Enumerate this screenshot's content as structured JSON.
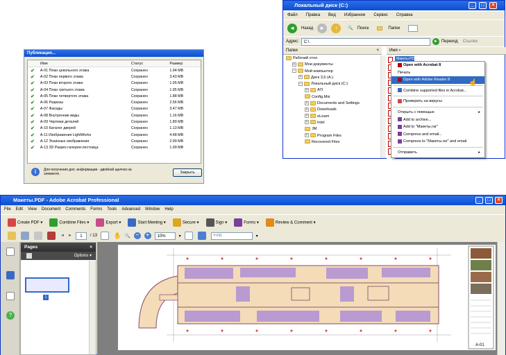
{
  "publish_dialog": {
    "title": "Публикация...",
    "columns": {
      "name": "Имя",
      "status": "Статус",
      "size": "Размер"
    },
    "rows": [
      {
        "name": "А-01 План цокольного этажа",
        "status": "Сохранен",
        "size": "1.94 MB"
      },
      {
        "name": "А-02 План первого этажа",
        "status": "Сохранен",
        "size": "3.43 MB"
      },
      {
        "name": "А-03 План второго этажа",
        "status": "Сохранен",
        "size": "1.95 MB"
      },
      {
        "name": "А-04 План третьего этажа",
        "status": "Сохранен",
        "size": "1.95 MB"
      },
      {
        "name": "А-05 План четвертого этажа",
        "status": "Сохранен",
        "size": "1.88 MB"
      },
      {
        "name": "А-06 Разрезы",
        "status": "Сохранен",
        "size": "2.56 MB"
      },
      {
        "name": "А-07 Фасады",
        "status": "Сохранен",
        "size": "3.47 MB"
      },
      {
        "name": "А-08 Внутренние виды",
        "status": "Сохранен",
        "size": "1.16 MB"
      },
      {
        "name": "А-09 Чертежи деталей",
        "status": "Сохранен",
        "size": "1.89 MB"
      },
      {
        "name": "А-10 Каталог дверей",
        "status": "Сохранен",
        "size": "1.13 MB"
      },
      {
        "name": "А-11 Изображения LightWorks",
        "status": "Сохранен",
        "size": "4.48 MB"
      },
      {
        "name": "А-12 Эскизные изображения",
        "status": "Сохранен",
        "size": "2.99 MB"
      },
      {
        "name": "А-13 3D Разрез галереи-лестница",
        "status": "Сохранен",
        "size": "1.99 MB"
      }
    ],
    "info_text": "Для получения доп. информации - двойной щелчок на элементе.",
    "close_label": "Закрыть"
  },
  "explorer": {
    "title": "Локальный диск (C:)",
    "menu": [
      "Файл",
      "Правка",
      "Вид",
      "Избранное",
      "Сервис",
      "Справка"
    ],
    "toolbar": {
      "back": "Назад",
      "search": "Поиск",
      "folders": "Папки"
    },
    "address_label": "Адрес:",
    "address_value": "C:\\",
    "go_label": "Переход",
    "links_label": "Ссылки",
    "folders_header": "Папки",
    "name_header": "Имя",
    "tree": [
      {
        "label": "Рабочий стол",
        "indent": 0,
        "pm": ""
      },
      {
        "label": "Мои документы",
        "indent": 1,
        "pm": "+"
      },
      {
        "label": "Мой компьютер",
        "indent": 1,
        "pm": "−"
      },
      {
        "label": "Диск 3,5 (A:)",
        "indent": 2,
        "pm": "+"
      },
      {
        "label": "Локальный диск (C:)",
        "indent": 2,
        "pm": "−"
      },
      {
        "label": "ATI",
        "indent": 3,
        "pm": "+"
      },
      {
        "label": "Config.Msi",
        "indent": 3,
        "pm": ""
      },
      {
        "label": "Documents and Settings",
        "indent": 3,
        "pm": "+"
      },
      {
        "label": "Downloads",
        "indent": 3,
        "pm": "+"
      },
      {
        "label": "eLearn",
        "indent": 3,
        "pm": "+"
      },
      {
        "label": "Intel",
        "indent": 3,
        "pm": "+"
      },
      {
        "label": "JM",
        "indent": 3,
        "pm": ""
      },
      {
        "label": "Program Files",
        "indent": 3,
        "pm": "+"
      },
      {
        "label": "Recovered Files",
        "indent": 3,
        "pm": ""
      }
    ],
    "selected_file": "Макеты.PDF"
  },
  "context_menu": {
    "items": [
      {
        "label": "Open with Acrobat 8",
        "bold": true
      },
      {
        "label": "Печать"
      },
      {
        "label": "Open with Adobe Reader 8",
        "selected": true
      },
      {
        "sep": true
      },
      {
        "label": "Combine supported files in Acrobat..."
      },
      {
        "sep": true
      },
      {
        "label": "Проверить на вирусы"
      },
      {
        "sep": true
      },
      {
        "label": "Открыть с помощью",
        "arrow": true
      },
      {
        "label": "Add to archive..."
      },
      {
        "label": "Add to \"Макеты.rar\""
      },
      {
        "label": "Compress and email..."
      },
      {
        "label": "Compress to \"Макеты.rar\" and email"
      },
      {
        "sep": true
      },
      {
        "label": "Отправить",
        "arrow": true
      }
    ]
  },
  "acrobat": {
    "title": "Макеты.PDF - Adobe Acrobat Professional",
    "menu": [
      "File",
      "Edit",
      "View",
      "Document",
      "Comments",
      "Forms",
      "Tools",
      "Advanced",
      "Window",
      "Help"
    ],
    "tasks": [
      "Create PDF",
      "Combine Files",
      "Export",
      "Start Meeting",
      "Secure",
      "Sign",
      "Forms",
      "Review & Comment"
    ],
    "page_current": "1",
    "page_total": "/ 13",
    "zoom": "10%",
    "find_placeholder": "Find",
    "pages_title": "Pages",
    "options_label": "Options",
    "thumb_label": "1",
    "sheet_code": "A-01"
  },
  "colors": {
    "xp_blue": "#0a4fd7",
    "selection": "#316ac5",
    "plan_fill": "#f3dcb7",
    "plan_accent": "#b08fd6"
  }
}
